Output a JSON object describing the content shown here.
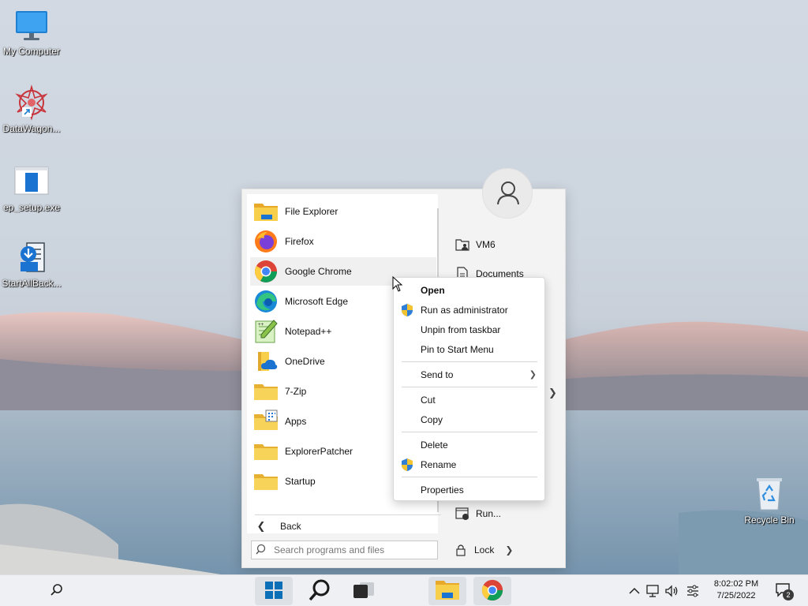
{
  "desktop": {
    "icons": [
      {
        "label": "My Computer",
        "icon": "monitor-icon"
      },
      {
        "label": "DataWagon...",
        "icon": "datawagon-icon"
      },
      {
        "label": "ep_setup.exe",
        "icon": "installer-icon"
      },
      {
        "label": "StartAllBack...",
        "icon": "startallback-icon"
      },
      {
        "label": "Recycle Bin",
        "icon": "recycle-bin-icon"
      }
    ]
  },
  "start_menu": {
    "programs": [
      {
        "label": "File Explorer",
        "icon": "folder-explorer-icon"
      },
      {
        "label": "Firefox",
        "icon": "firefox-icon"
      },
      {
        "label": "Google Chrome",
        "icon": "chrome-icon"
      },
      {
        "label": "Microsoft Edge",
        "icon": "edge-icon"
      },
      {
        "label": "Notepad++",
        "icon": "notepadpp-icon"
      },
      {
        "label": "OneDrive",
        "icon": "onedrive-icon"
      },
      {
        "label": "7-Zip",
        "icon": "folder-icon"
      },
      {
        "label": "Apps",
        "icon": "folder-apps-icon"
      },
      {
        "label": "ExplorerPatcher",
        "icon": "folder-icon"
      },
      {
        "label": "Startup",
        "icon": "folder-icon"
      }
    ],
    "back_label": "Back",
    "search_placeholder": "Search programs and files",
    "right_items": [
      {
        "label": "VM6",
        "icon": "user-folder-icon"
      },
      {
        "label": "Documents",
        "icon": "document-icon"
      },
      {
        "label": "Run...",
        "icon": "run-icon"
      }
    ],
    "lock_label": "Lock"
  },
  "context_menu": {
    "items": [
      {
        "label": "Open",
        "bold": true
      },
      {
        "label": "Run as administrator",
        "icon": "shield-icon"
      },
      {
        "label": "Unpin from taskbar"
      },
      {
        "label": "Pin to Start Menu"
      },
      {
        "label": "Send to",
        "submenu": true
      },
      {
        "label": "Cut"
      },
      {
        "label": "Copy"
      },
      {
        "label": "Delete"
      },
      {
        "label": "Rename",
        "icon": "shield-icon"
      },
      {
        "label": "Properties"
      }
    ]
  },
  "taskbar": {
    "buttons": [
      "search-icon",
      "start-icon",
      "search-magnifier-icon",
      "task-view-icon",
      "file-explorer-icon",
      "chrome-icon"
    ],
    "clock": {
      "time": "8:02:02 PM",
      "date": "7/25/2022"
    },
    "notification_count": "2"
  },
  "colors": {
    "accent": "#0067c0",
    "folder_yellow": "#f5c842",
    "menu_bg": "#f3f3f3"
  }
}
